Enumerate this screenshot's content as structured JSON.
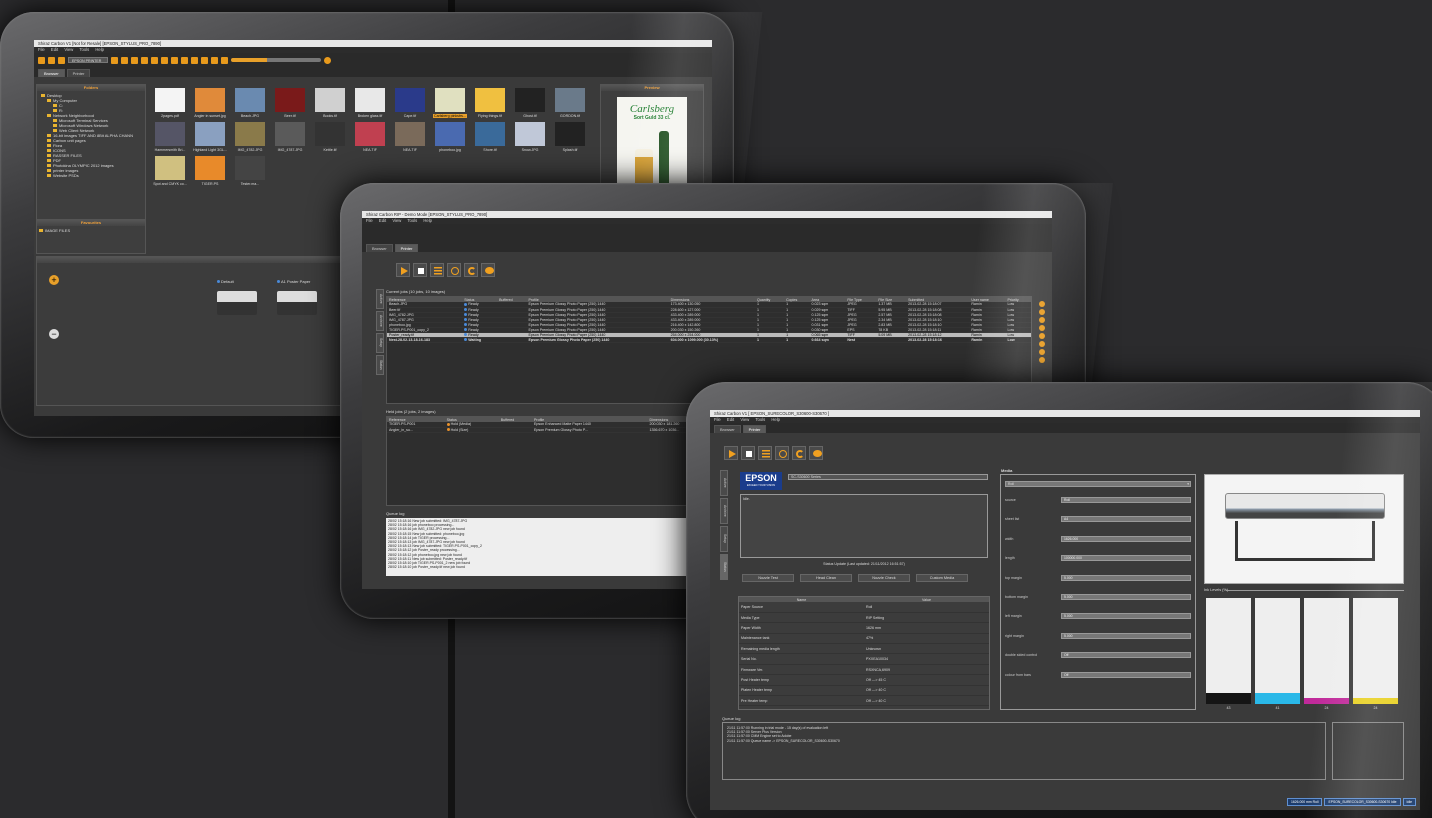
{
  "browser_window": {
    "title": "Shiraz Carbon V1 [Not for Resale] [EPSON_STYLUS_PRO_7890]",
    "menu": [
      "File",
      "Edit",
      "View",
      "Tools",
      "Help"
    ],
    "printer_select": "EPSON PRINTER",
    "tabs": [
      "Browser",
      "Printer"
    ],
    "folders_header": "Folders",
    "tree": [
      "Desktop",
      "My Computer",
      "C:",
      "R:",
      "Network Neighborhood",
      "Microsoft Terminal Services",
      "Microsoft Windows Network",
      "Web Client Network",
      "16-bit images TIFF AND 8Bit ALPHA CHANN",
      "Carbon unit pages",
      "Flora",
      "ICONS",
      "RASSER FILES",
      "PDF",
      "Photokina OLYMPIC 2012 images",
      "printer images",
      "Website PSDs"
    ],
    "favourites_header": "Favourites",
    "favourites": [
      "IMAGE FILES"
    ],
    "preview_header": "Preview",
    "preview_text": [
      "Carlsberg",
      "Sort Guld 33 cl."
    ],
    "printflow_header": "PrintFlow",
    "printflow_nodes": [
      "Default",
      "A1 Poster Paper"
    ],
    "thumbnails": [
      {
        "caption": "2pages.pdf",
        "color": "#f4f4f4"
      },
      {
        "caption": "Angler in sunset.jpg",
        "color": "#e08a3a"
      },
      {
        "caption": "Beach.JPG",
        "color": "#6a8ab0"
      },
      {
        "caption": "Beer.tif",
        "color": "#7a1a1a"
      },
      {
        "caption": "Books.tif",
        "color": "#d0d0d0"
      },
      {
        "caption": "Broken glass.tif",
        "color": "#e8e8e8"
      },
      {
        "caption": "Cape.tif",
        "color": "#2a3a8a"
      },
      {
        "caption": "Carlsberg pinkstrs...",
        "color": "#e0e0c0"
      },
      {
        "caption": "Flying things.tif",
        "color": "#f0c040"
      },
      {
        "caption": "Ghost.tif",
        "color": "#222"
      },
      {
        "caption": "GORDON.tif",
        "color": "#6a7a8a"
      },
      {
        "caption": "Hammersmith Bri...",
        "color": "#556"
      },
      {
        "caption": "Highland Light 3GL...",
        "color": "#8aa0c0"
      },
      {
        "caption": "IMG_4782.JPG",
        "color": "#8a7a4a"
      },
      {
        "caption": "IMG_4787.JPG",
        "color": "#5a5a5a"
      },
      {
        "caption": "Kettle.tif",
        "color": "#333"
      },
      {
        "caption": "NEA.TIF",
        "color": "#c04050"
      },
      {
        "caption": "NEA.TIF",
        "color": "#7a6a5a"
      },
      {
        "caption": "phoneboo.jpg",
        "color": "#4a6ab0"
      },
      {
        "caption": "Shore.tif",
        "color": "#3a6a9a"
      },
      {
        "caption": "Snow.JPG",
        "color": "#c0c8d8"
      },
      {
        "caption": "Splash.tif",
        "color": "#222"
      },
      {
        "caption": "Spot and CMYK co...",
        "color": "#d0c080"
      },
      {
        "caption": "TIGER.PS",
        "color": "#e88a2a"
      },
      {
        "caption": "Tester.ma...",
        "color": "#444"
      }
    ]
  },
  "demo_window": {
    "title": "Shiraz Carbon RIP - Demo Mode [EPSON_STYLUS_PRO_7890]",
    "menu": [
      "File",
      "Edit",
      "View",
      "Tools",
      "Help"
    ],
    "tabs": [
      "Browser",
      "Printer"
    ],
    "vtabs": [
      "Active",
      "Archive",
      "Setup",
      "Status"
    ],
    "current_jobs_label": "Current jobs (10 jobs, 10 images)",
    "current_headers": [
      "Reference",
      "Status",
      "Buffered",
      "Profile",
      "Dimensions",
      "Quantity",
      "Copies",
      "Area",
      "File Type",
      "File Size",
      "Submitted",
      "User name",
      "Priority"
    ],
    "current_rows": [
      [
        "Beach.JPG",
        "Ready",
        "",
        "Epson Premium Glossy Photo Paper (250) 1440",
        "173.400 x 130.050",
        "1",
        "1",
        "0.023 sqm",
        "JPEG",
        "1.37 MB",
        "2013-02-28 15:18:07",
        "Ramin",
        "Low"
      ],
      [
        "Beer.tif",
        "Ready",
        "",
        "Epson Premium Glossy Photo Paper (250) 1440",
        "228.600 x 127.000",
        "1",
        "1",
        "0.029 sqm",
        "TIFF",
        "5.95 MB",
        "2013-02-28 15:18:08",
        "Ramin",
        "Low"
      ],
      [
        "IMG_4782.JPG",
        "Ready",
        "",
        "Epson Premium Glossy Photo Paper (250) 1440",
        "433.400 x 289.000",
        "1",
        "1",
        "0.125 sqm",
        "JPEG",
        "2.57 MB",
        "2013-02-28 15:18:08",
        "Ramin",
        "Low"
      ],
      [
        "IMG_4787.JPG",
        "Ready",
        "",
        "Epson Premium Glossy Photo Paper (250) 1440",
        "433.400 x 289.000",
        "1",
        "1",
        "0.125 sqm",
        "JPEG",
        "2.34 MB",
        "2013-02-28 15:18:10",
        "Ramin",
        "Low"
      ],
      [
        "phoneboo.jpg",
        "Ready",
        "",
        "Epson Premium Glossy Photo Paper (250) 1440",
        "216.400 x 142.800",
        "1",
        "1",
        "0.031 sqm",
        "JPEG",
        "2.83 MB",
        "2013-02-28 15:18:10",
        "Ramin",
        "Low"
      ],
      [
        "TIGER.PS-P001_copy_2",
        "Ready",
        "",
        "Epson Premium Glossy Photo Paper (250) 1440",
        "200.030 x 150.260",
        "1",
        "1",
        "0.030 sqm",
        "EPS",
        "78 KB",
        "2013-02-28 15:18:11",
        "Ramin",
        "Low"
      ],
      [
        "Poster_ready.tif",
        "Ready",
        "",
        "Epson Premium Glossy Photo Paper (250) 1440",
        "254.000 x 254.000",
        "1",
        "1",
        "0.065 sqm",
        "TIFF",
        "5.09 MB",
        "2013-02-28 15:18:12",
        "Ramin",
        "Low"
      ],
      [
        "Nest-28-02-13-18-16-183",
        "Waiting",
        "",
        "Epson Premium Glossy Photo Paper (250) 1440",
        "604.000 x 1099.000 (30.13%)",
        "1",
        "1",
        "0.664 sqm",
        "Nest",
        "",
        "2013-02-28 15:18:16",
        "Ramin",
        "Low"
      ]
    ],
    "held_jobs_label": "Held jobs (2 jobs, 2 images)",
    "held_headers": [
      "Reference",
      "Status",
      "Buffered",
      "Profile",
      "Dimensions",
      "Quantity",
      "Copies"
    ],
    "held_rows": [
      [
        "TIGER.PS-P001",
        "Hold (Media)",
        "",
        "Epson Enhanced Matte Paper 1440",
        "200.030 x 181.260",
        "1",
        "1"
      ],
      [
        "Angler_in_su...",
        "Hold (Size)",
        "",
        "Epson Premium Glossy Photo P...",
        "1356.670 x 1036...",
        "1",
        "1"
      ]
    ],
    "queue_log_label": "Queue log",
    "queue_log": [
      "28/02 15:18:16 New job submitted: IMG_4787.JPG",
      "28/02 15:18:16 job phoneboo processing...",
      "28/02 15:18:16 job IMG_4782.JPG new job found",
      "28/02 15:18:15 New job submitted: phoneboo.jpg",
      "28/02 15:18:14 job TIGER processing...",
      "28/02 15:18:13 job IMG_4787.JPG new job found",
      "28/02 15:18:13 New job submitted: TIGER.PS-P001_copy_2",
      "28/02 15:18:12 job Poster_ready processing...",
      "28/02 15:18:12 job phoneboo.jpg new job found",
      "28/02 15:18:11 New job submitted: Poster_ready.tif",
      "28/02 15:18:10 job TIGER.PS-P001_2 new job found",
      "28/02 15:18:10 job Poster_ready.tif new job found"
    ]
  },
  "printer_window": {
    "title": "Shiraz Carbon V1 [ EPSON_SURECOLOR_S30600-S30670 ]",
    "menu": [
      "File",
      "Edit",
      "View",
      "Tools",
      "Help"
    ],
    "tabs": [
      "Browser",
      "Printer"
    ],
    "vtabs": [
      "Active",
      "Archive",
      "Setup",
      "Status"
    ],
    "epson_logo": "EPSON",
    "epson_tagline": "EXCEED YOUR VISION",
    "printer_model": "SC-S30600 Series",
    "status_idle": "Idle.",
    "status_update": "Status Update (Last updated: 21/11/2012 16:51:57)",
    "buttons": [
      "Nozzle Test",
      "Head Clean",
      "Nozzle Check",
      "Custom Media"
    ],
    "info_headers": [
      "Name",
      "Value"
    ],
    "info_rows": [
      [
        "Paper Source",
        "Roll"
      ],
      [
        "Media Type",
        "RIP Setting"
      ],
      [
        "Paper Width",
        "1626 mm"
      ],
      [
        "Maintenance tank",
        "47%"
      ],
      [
        "Remaining media length",
        "Unknown"
      ],
      [
        "Serial No.",
        "PXXEA10034"
      ],
      [
        "Firmware Ver.",
        "RSXNCA,6909"
      ],
      [
        "Post Heater temp",
        "Off ---> 45 C"
      ],
      [
        "Platen Heater temp",
        "Off ---> 40 C"
      ],
      [
        "Pre Heater temp",
        "Off ---> 40 C"
      ]
    ],
    "media_header": "Media",
    "media_select": "Roll",
    "media_fields": [
      {
        "label": "source",
        "value": "Roll"
      },
      {
        "label": "sheet list",
        "value": "A4"
      },
      {
        "label": "width",
        "value": "1626.000"
      },
      {
        "label": "length",
        "value": "100000.000"
      },
      {
        "label": "top margin",
        "value": "5.000"
      },
      {
        "label": "bottom margin",
        "value": "5.000"
      },
      {
        "label": "left margin",
        "value": "5.000"
      },
      {
        "label": "right margin",
        "value": "5.000"
      },
      {
        "label": "double sided control",
        "value": "Off"
      },
      {
        "label": "colour from bars",
        "value": "Off"
      }
    ],
    "ink_header": "Ink Levels (%)",
    "ink": [
      {
        "label": "43",
        "color": "#151515",
        "level": 0.43
      },
      {
        "label": "41",
        "color": "#2ab8e8",
        "level": 0.41
      },
      {
        "label": "24",
        "color": "#c02a9a",
        "level": 0.24
      },
      {
        "label": "24",
        "color": "#e8d020",
        "level": 0.24
      }
    ],
    "queue_log_label": "Queue log",
    "queue_log": [
      "21/11 11:57:00 Running in trial mode - 15 day(s) of evaluation left",
      "21/11 11:57:00 Server Plus Version",
      "21/11 11:57:00 CMM Engine set to Adobe",
      "21/11 11:57:00 Queue name -> EPSON_SURECOLOR_S30600-S30670"
    ],
    "statusbar": [
      "1626.000 mm Roll",
      "EPSON_SURECOLOR_S30600-S30670 Idle",
      "Idle"
    ]
  }
}
